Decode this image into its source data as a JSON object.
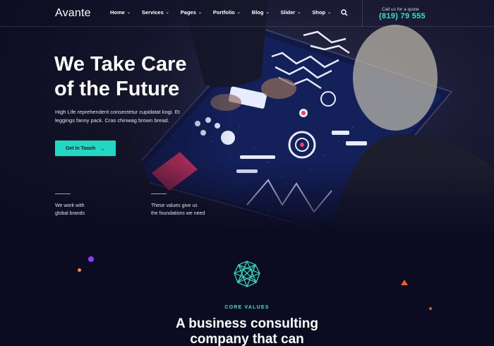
{
  "header": {
    "logo": "Avante",
    "nav": [
      {
        "label": "Home"
      },
      {
        "label": "Services"
      },
      {
        "label": "Pages"
      },
      {
        "label": "Portfolio"
      },
      {
        "label": "Blog"
      },
      {
        "label": "Slider"
      },
      {
        "label": "Shop"
      }
    ],
    "search_icon": "search-icon",
    "quote_label": "Call us for a quote",
    "quote_phone": "(819) 79 555"
  },
  "hero": {
    "title_line1": "We Take Care",
    "title_line2": "of the Future",
    "description_line1": "High Life reprehenderit consectetur cupidatat kogi. Et",
    "description_line2": "leggings fanny pack. Cras chinwag brown bread.",
    "cta_label": "Get In Touch",
    "cta_icon": "arrow-right-icon",
    "features": [
      {
        "line1": "We work with",
        "line2": "global brands"
      },
      {
        "line1": "These values give us",
        "line2": "the foundations we need"
      }
    ]
  },
  "section": {
    "icon": "geometric-network-icon",
    "label": "CORE VALUES",
    "title_line1": "A business consulting",
    "title_line2": "company that can"
  },
  "colors": {
    "accent": "#22d8c3",
    "phone": "#2fe5c8",
    "background": "#0b0b22",
    "dot_purple": "#8a3dff",
    "dot_orange": "#ff8a2a",
    "triangle": "#ff5a1a"
  }
}
